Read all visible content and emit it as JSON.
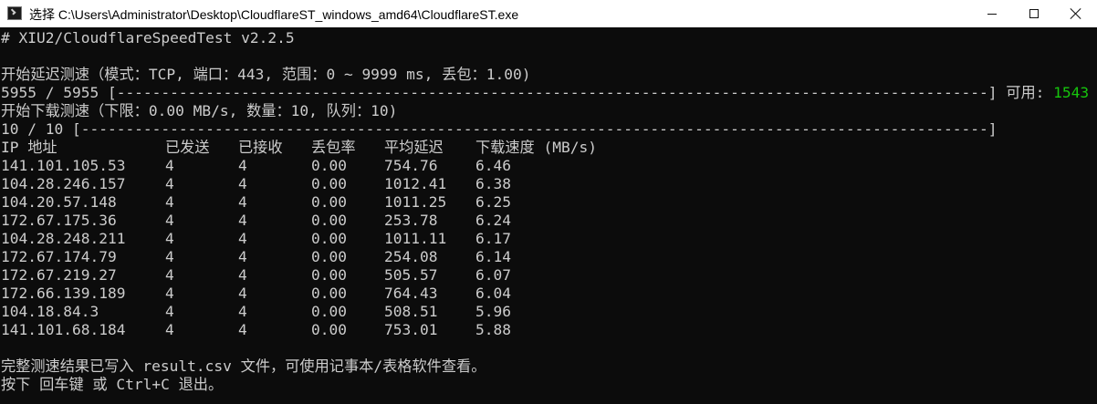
{
  "window": {
    "title": "选择 C:\\Users\\Administrator\\Desktop\\CloudflareST_windows_amd64\\CloudflareST.exe",
    "icon": "console-icon",
    "controls": [
      "minimize-icon",
      "maximize-icon",
      "close-icon"
    ]
  },
  "console": {
    "header": "# XIU2/CloudflareSpeedTest v2.2.5",
    "latency_test_line": "开始延迟测速（模式：TCP, 端口：443, 范围：0 ~ 9999 ms, 丢包：1.00)",
    "latency_progress": {
      "text": "5955 / 5955 [--------------------------------------------------------------------------------------------------] 可用: ",
      "available": "1543",
      "available_color": "#16c60c"
    },
    "download_test_line": "开始下载测速（下限：0.00 MB/s, 数量：10, 队列：10)",
    "download_progress": "10 / 10 [------------------------------------------------------------------------------------------------------]",
    "table": {
      "headers": [
        "IP 地址",
        "已发送",
        "已接收",
        "丢包率",
        "平均延迟",
        "下载速度 (MB/s)"
      ],
      "rows": [
        [
          "141.101.105.53",
          "4",
          "4",
          "0.00",
          "754.76",
          "6.46"
        ],
        [
          "104.28.246.157",
          "4",
          "4",
          "0.00",
          "1012.41",
          "6.38"
        ],
        [
          "104.20.57.148",
          "4",
          "4",
          "0.00",
          "1011.25",
          "6.25"
        ],
        [
          "172.67.175.36",
          "4",
          "4",
          "0.00",
          "253.78",
          "6.24"
        ],
        [
          "104.28.248.211",
          "4",
          "4",
          "0.00",
          "1011.11",
          "6.17"
        ],
        [
          "172.67.174.79",
          "4",
          "4",
          "0.00",
          "254.08",
          "6.14"
        ],
        [
          "172.67.219.27",
          "4",
          "4",
          "0.00",
          "505.57",
          "6.07"
        ],
        [
          "172.66.139.189",
          "4",
          "4",
          "0.00",
          "764.43",
          "6.04"
        ],
        [
          "104.18.84.3",
          "4",
          "4",
          "0.00",
          "508.51",
          "5.96"
        ],
        [
          "141.101.68.184",
          "4",
          "4",
          "0.00",
          "753.01",
          "5.88"
        ]
      ]
    },
    "result_line": "完整测速结果已写入 result.csv 文件，可使用记事本/表格软件查看。",
    "exit_line": "按下 回车键 或 Ctrl+C 退出。"
  }
}
